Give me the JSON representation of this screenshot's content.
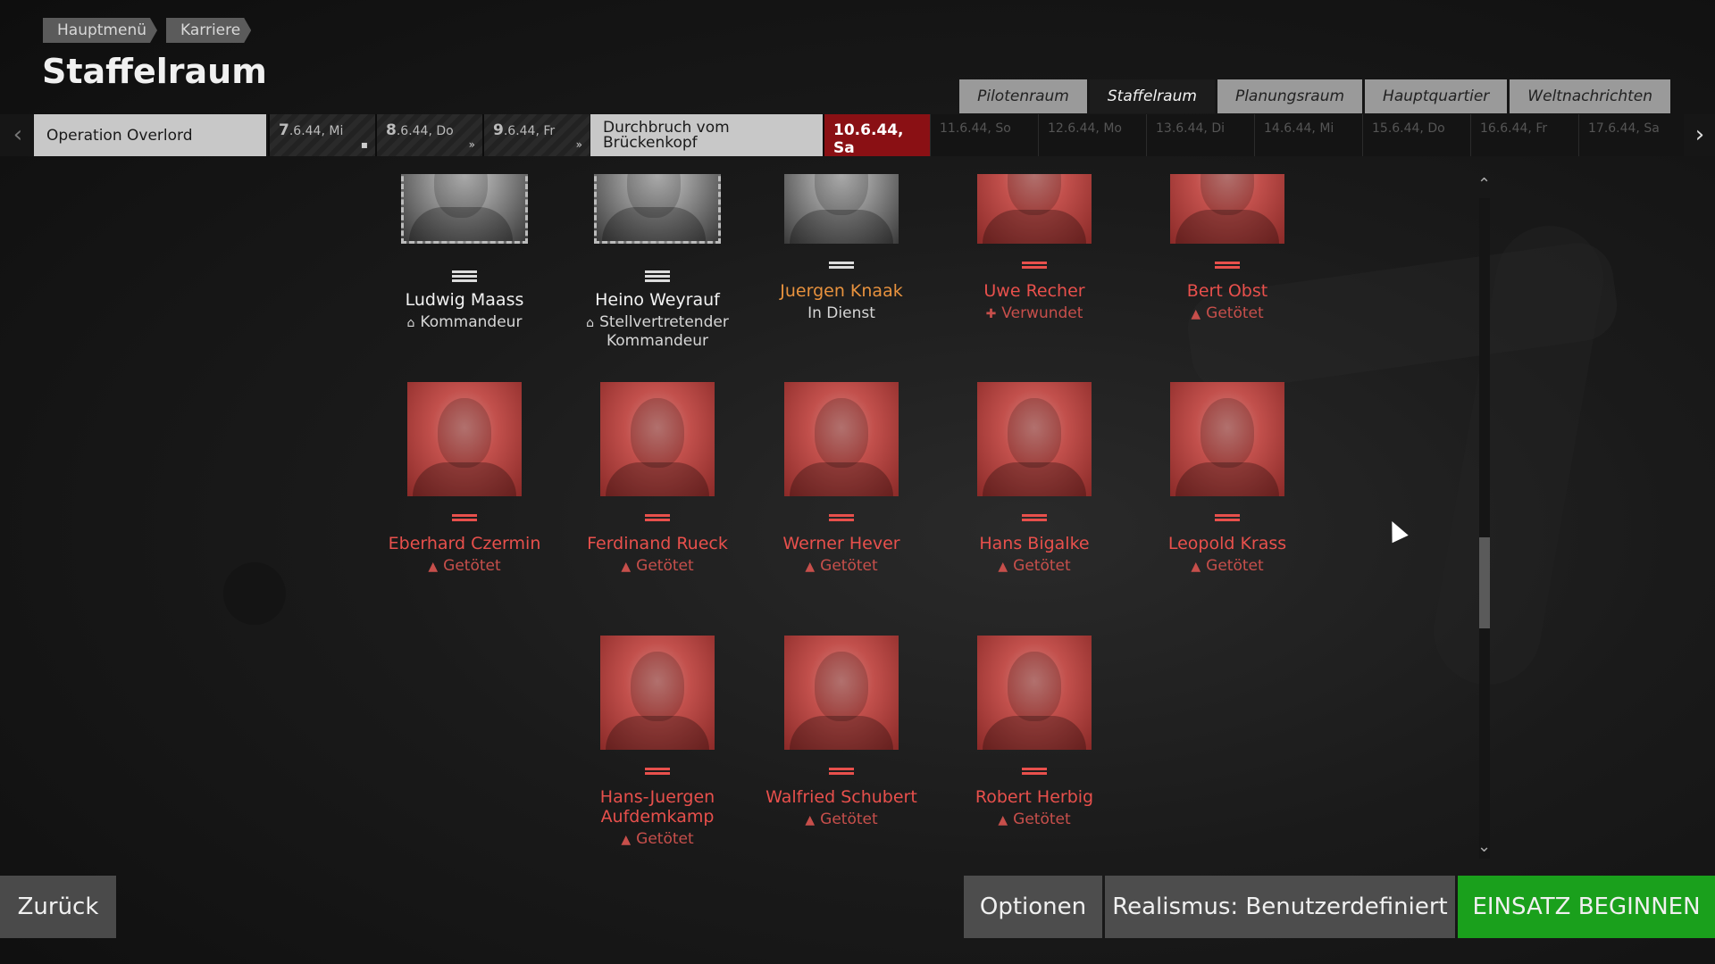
{
  "breadcrumb": [
    "Hauptmenü",
    "Karriere"
  ],
  "page_title": "Staffelraum",
  "tabs": [
    {
      "label": "Pilotenraum",
      "active": false
    },
    {
      "label": "Staffelraum",
      "active": true
    },
    {
      "label": "Planungsraum",
      "active": false
    },
    {
      "label": "Hauptquartier",
      "active": false
    },
    {
      "label": "Weltnachrichten",
      "active": false
    }
  ],
  "timeline": {
    "operation1": "Operation Overlord",
    "operation2": "Durchbruch vom Brückenkopf",
    "days": [
      {
        "num": "7",
        "rest": ".6.44, Mi"
      },
      {
        "num": "8",
        "rest": ".6.44, Do"
      },
      {
        "num": "9",
        "rest": ".6.44, Fr"
      },
      {
        "num": "10.6.44, Sa",
        "rest": ""
      },
      {
        "num": "11.6.44, So",
        "rest": ""
      },
      {
        "num": "12.6.44, Mo",
        "rest": ""
      },
      {
        "num": "13.6.44, Di",
        "rest": ""
      },
      {
        "num": "14.6.44, Mi",
        "rest": ""
      },
      {
        "num": "15.6.44, Do",
        "rest": ""
      },
      {
        "num": "16.6.44, Fr",
        "rest": ""
      },
      {
        "num": "17.6.44, Sa",
        "rest": ""
      }
    ]
  },
  "pilots": [
    {
      "name": "Ludwig Maass",
      "status": "Kommandeur",
      "state": "alive"
    },
    {
      "name": "Heino Weyrauf",
      "status": "Stellvertretender Kommandeur",
      "state": "alive"
    },
    {
      "name": "Juergen Knaak",
      "status": "In Dienst",
      "state": "active"
    },
    {
      "name": "Uwe Recher",
      "status": "Verwundet",
      "state": "wounded"
    },
    {
      "name": "Bert Obst",
      "status": "Getötet",
      "state": "killed"
    },
    {
      "name": "Eberhard Czermin",
      "status": "Getötet",
      "state": "killed"
    },
    {
      "name": "Ferdinand Rueck",
      "status": "Getötet",
      "state": "killed"
    },
    {
      "name": "Werner Hever",
      "status": "Getötet",
      "state": "killed"
    },
    {
      "name": "Hans Bigalke",
      "status": "Getötet",
      "state": "killed"
    },
    {
      "name": "Leopold Krass",
      "status": "Getötet",
      "state": "killed"
    },
    {
      "name": "Hans-Juergen Aufdemkamp",
      "status": "Getötet",
      "state": "killed"
    },
    {
      "name": "Walfried Schubert",
      "status": "Getötet",
      "state": "killed"
    },
    {
      "name": "Robert Herbig",
      "status": "Getötet",
      "state": "killed"
    }
  ],
  "footer": {
    "back": "Zurück",
    "options": "Optionen",
    "realism": "Realismus: Benutzerdefiniert",
    "start": "EINSATZ BEGINNEN"
  },
  "colors": {
    "killed": "#e8504c",
    "active": "#e8923e",
    "today": "#8a1014",
    "start_button": "#1aa01c"
  }
}
